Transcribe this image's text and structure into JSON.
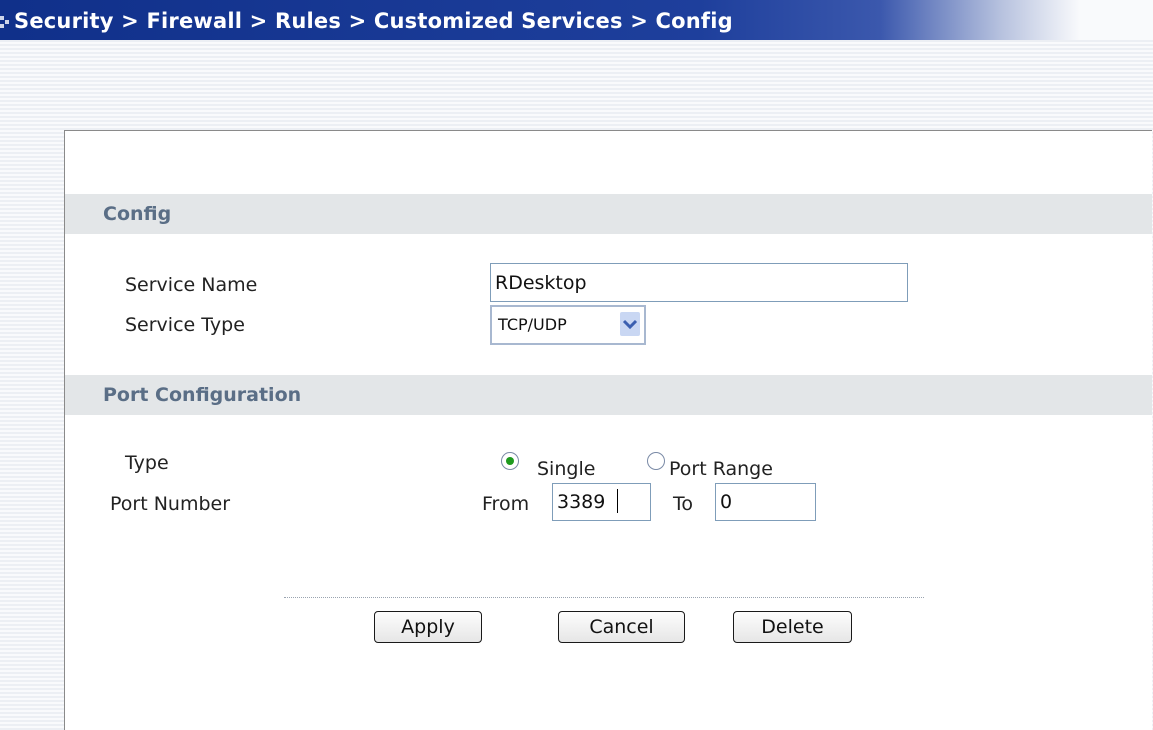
{
  "header": {
    "breadcrumb": "Security > Firewall > Rules > Customized Services > Config"
  },
  "config_section": {
    "title": "Config",
    "service_name_label": "Service Name",
    "service_name_value": "RDesktop",
    "service_type_label": "Service Type",
    "service_type_value": "TCP/UDP"
  },
  "port_section": {
    "title": "Port Configuration",
    "type_label": "Type",
    "type_options": [
      "Single",
      "Port Range"
    ],
    "type_selected": "Single",
    "port_number_label": "Port Number",
    "from_label": "From",
    "from_value": "3389",
    "to_label": "To",
    "to_value": "0"
  },
  "buttons": {
    "apply": "Apply",
    "cancel": "Cancel",
    "delete": "Delete"
  },
  "colors": {
    "header_blue": "#1e3f9c",
    "section_title": "#5a6e86",
    "radio_selected": "#1e9a1e"
  }
}
